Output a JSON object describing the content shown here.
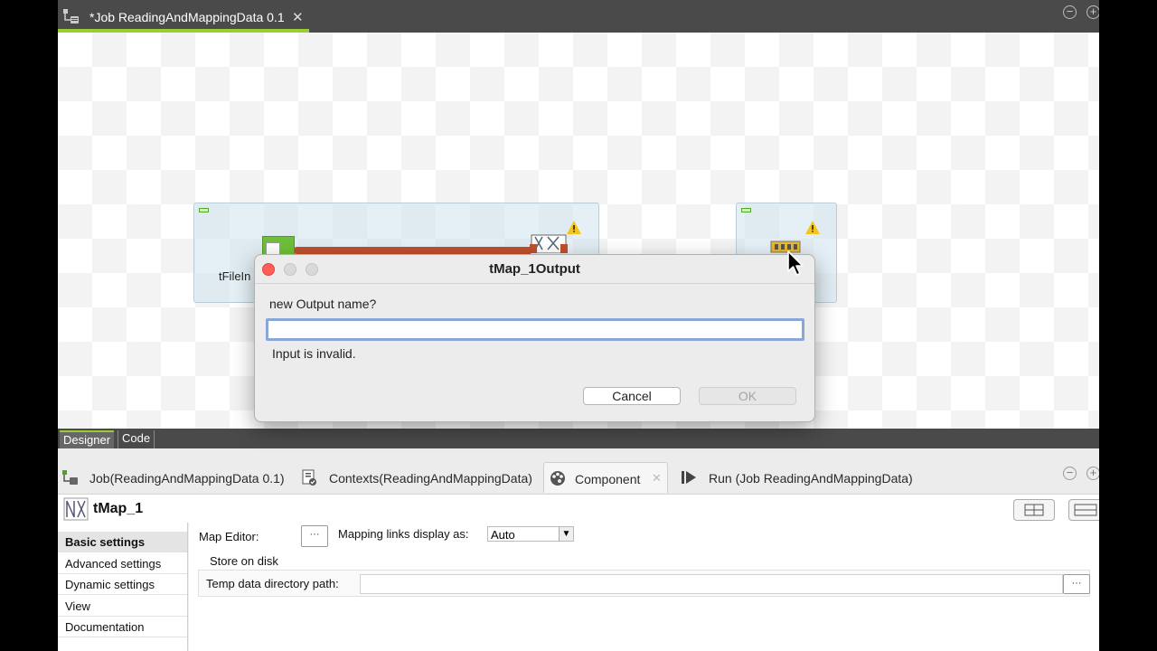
{
  "editor": {
    "tab_title": "*Job ReadingAndMappingData 0.1",
    "tab_close": "✕",
    "minimize": "−",
    "maximize": "+"
  },
  "canvas": {
    "component_label": "tFileIn"
  },
  "design_tabs": {
    "designer": "Designer",
    "code": "Code"
  },
  "view_tabs": {
    "job": "Job(ReadingAndMappingData 0.1)",
    "contexts": "Contexts(ReadingAndMappingData)",
    "component": "Component",
    "component_close": "✕",
    "run": "Run (Job ReadingAndMappingData)",
    "minimize": "−",
    "maximize": "+"
  },
  "component_panel": {
    "title": "tMap_1",
    "nav": {
      "items": [
        {
          "label": "Basic settings",
          "active": true
        },
        {
          "label": "Advanced settings",
          "active": false
        },
        {
          "label": "Dynamic settings",
          "active": false
        },
        {
          "label": "View",
          "active": false
        },
        {
          "label": "Documentation",
          "active": false
        }
      ]
    },
    "settings": {
      "map_editor_label": "Map Editor:",
      "map_editor_button": "···",
      "mapping_links_label": "Mapping links display as:",
      "mapping_links_value": "Auto",
      "store_on_disk_label": "Store on disk",
      "temp_dir_label": "Temp data directory path:",
      "temp_dir_value": "",
      "temp_dir_button": "···"
    }
  },
  "dialog": {
    "title": "tMap_1Output",
    "prompt": "new Output name?",
    "input_value": "",
    "error": "Input is invalid.",
    "cancel": "Cancel",
    "ok": "OK"
  },
  "colors": {
    "accent_green": "#9acd32",
    "focus_ring": "#8aa6d6",
    "close_red": "#ff5f57",
    "warning": "#f5c518"
  },
  "icons": [
    "job-icon",
    "warning-icon",
    "component-palette-icon",
    "run-icon",
    "contexts-icon",
    "tmap-icon",
    "cursor-arrow"
  ]
}
